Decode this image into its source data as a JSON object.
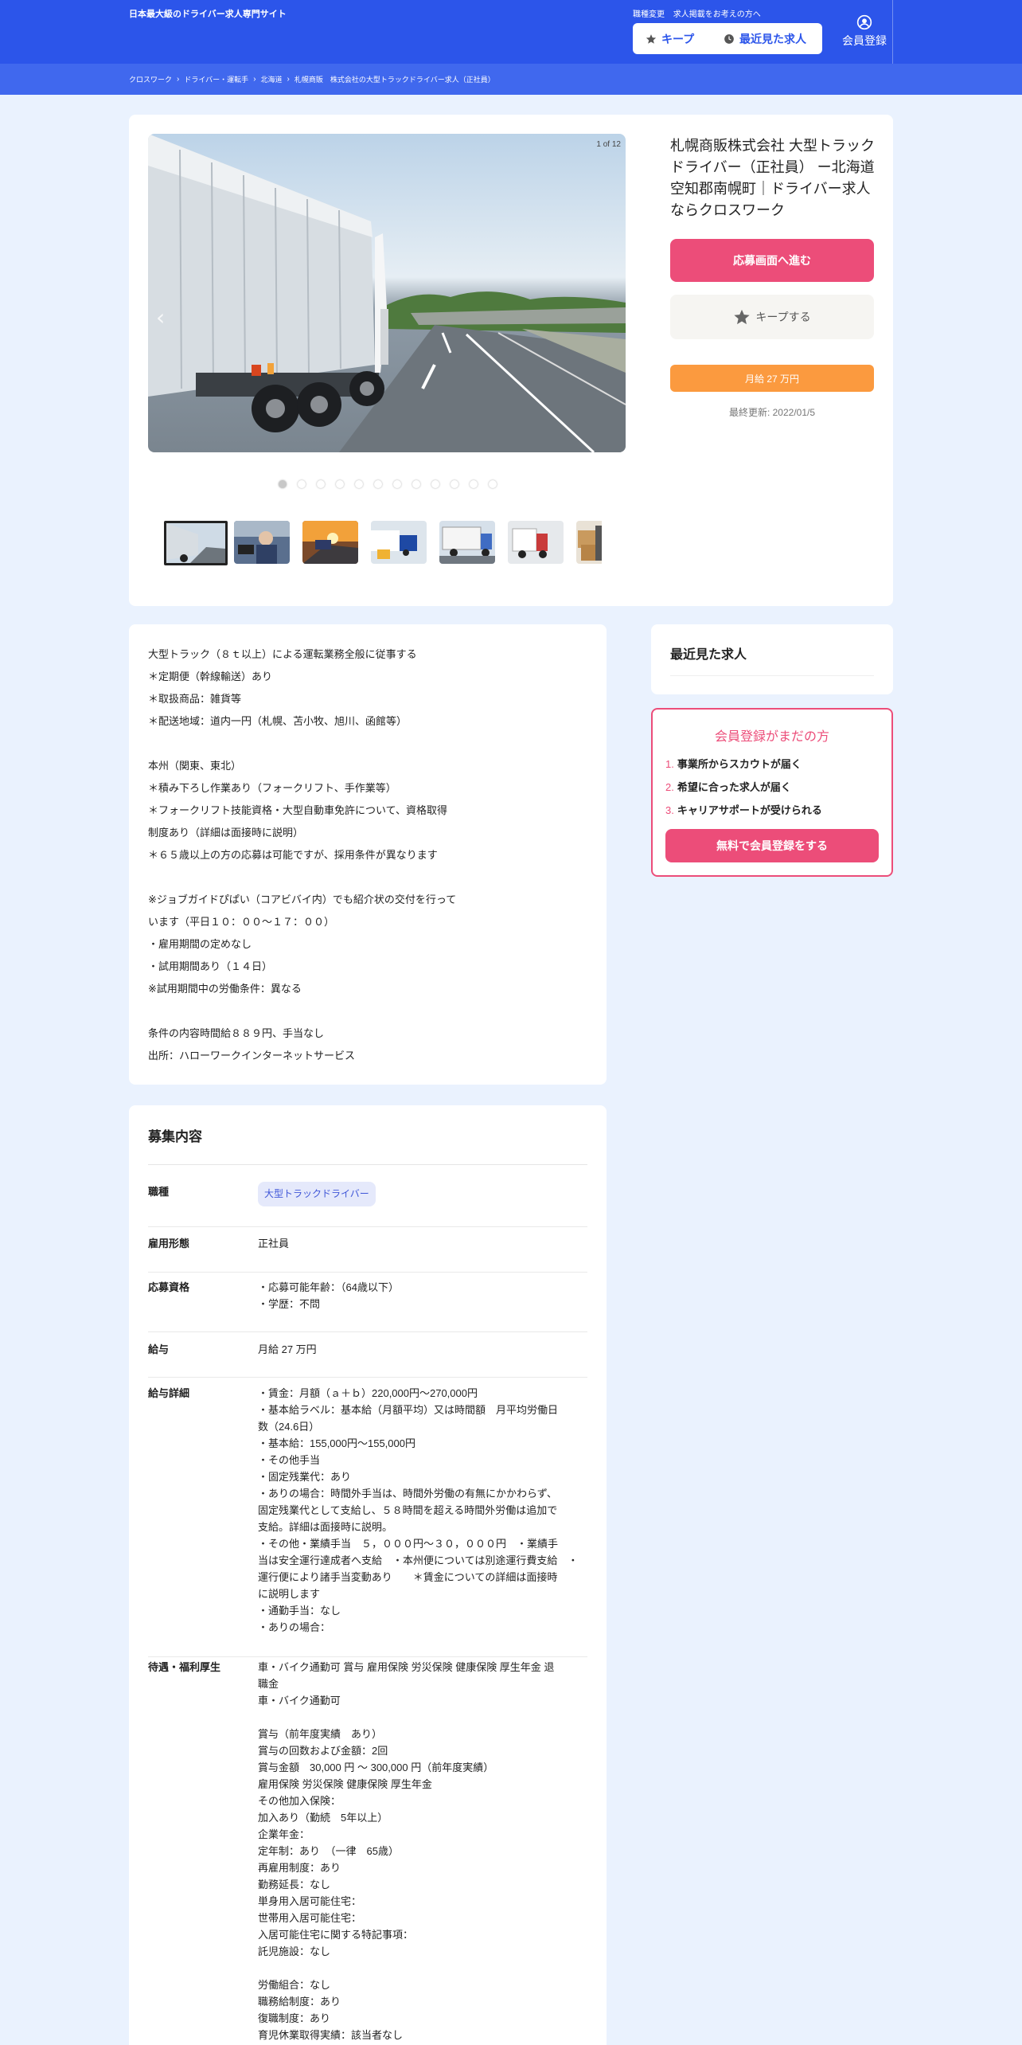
{
  "header": {
    "tagline": "日本最大級のドライバー求人専門サイト",
    "top_links": [
      "職種変更",
      "求人掲載をお考えの方へ"
    ],
    "keep_label": "キープ",
    "recent_label": "最近見た求人",
    "member_label": "会員登録",
    "accent": "#2c55ea"
  },
  "breadcrumb": [
    "クロスワーク",
    "ドライバー・運転手",
    "北海道",
    "札幌商販　株式会社の大型トラックドライバー求人（正社員）"
  ],
  "job": {
    "photo_counter": "1 of 12",
    "title": "札幌商販株式会社 大型トラックドライバー（正社員） ー北海道空知郡南幌町｜ドライバー求人ならクロスワーク",
    "apply_label": "応募画面へ進む",
    "keep_label": "キープする",
    "salary": "月給 27 万円",
    "updated": "最終更新: 2022/01/5",
    "slide_count": 12,
    "active_slide": 1
  },
  "description": [
    "大型トラック（８ｔ以上）による運転業務全般に従事する",
    "＊定期便（幹線輸送）あり",
    "＊取扱商品：雑貨等",
    "＊配送地域：道内一円（札幌、苫小牧、旭川、函館等）",
    "",
    "本州（関東、東北）",
    "＊積み下ろし作業あり（フォークリフト、手作業等）",
    "＊フォークリフト技能資格・大型自動車免許について、資格取得",
    "制度あり（詳細は面接時に説明）",
    "＊６５歳以上の方の応募は可能ですが、採用条件が異なります",
    "",
    "※ジョブガイドぴぱい（コアビバイ内）でも紹介状の交付を行って",
    "います（平日１０：００〜１７：００）",
    "・雇用期間の定めなし",
    "・試用期間あり（１４日）",
    "※試用期間中の労働条件：異なる",
    "",
    "条件の内容時間給８８９円、手当なし",
    "出所：ハローワークインターネットサービス"
  ],
  "recent": {
    "title": "最近見た求人"
  },
  "register": {
    "title": "会員登録がまだの方",
    "items": [
      {
        "num": "1.",
        "text": "事業所からスカウトが届く"
      },
      {
        "num": "2.",
        "text": "希望に合った求人が届く"
      },
      {
        "num": "3.",
        "text": "キャリアサポートが受けられる"
      }
    ],
    "button": "無料で会員登録をする",
    "accent": "#ec4d79"
  },
  "requirements": {
    "title": "募集内容",
    "job_type_label": "職種",
    "job_type_chip": "大型トラックドライバー",
    "employment_label": "雇用形態",
    "employment": [
      "正社員"
    ],
    "qualification_label": "応募資格",
    "qualification": [
      "・応募可能年齢：（64歳以下）",
      "・学歴：不問"
    ],
    "salary_label": "給与",
    "salary": [
      "月給 27 万円"
    ],
    "salary_detail_label": "給与詳細",
    "salary_detail": [
      "・賃金：月額（ａ＋ｂ）220,000円〜270,000円",
      "・基本給ラベル：基本給（月額平均）又は時間額　月平均労働日",
      "数（24.6日）",
      "・基本給：155,000円〜155,000円",
      "・その他手当",
      "・固定残業代：あり",
      "・ありの場合：時間外手当は、時間外労働の有無にかかわらず、",
      "固定残業代として支給し、５８時間を超える時間外労働は追加で",
      "支給。詳細は面接時に説明。",
      "・その他・業績手当　５，０００円〜３０，０００円　・業績手",
      "当は安全運行達成者へ支給　・本州便については別途運行費支給　・",
      "運行便により諸手当変動あり　　＊賃金についての詳細は面接時",
      "に説明します",
      "・通勤手当：なし",
      "・ありの場合："
    ],
    "benefits_label": "待遇・福利厚生",
    "benefits": [
      "車・バイク通勤可 賞与 雇用保険 労災保険 健康保険 厚生年金 退",
      "職金",
      "車・バイク通勤可",
      "",
      "賞与（前年度実績　あり）",
      "賞与の回数および金額：2回",
      "賞与金額　30,000 円 〜 300,000 円（前年度実績）",
      "雇用保険 労災保険 健康保険 厚生年金",
      "その他加入保険：",
      "加入あり（勤続　5年以上）",
      "企業年金：",
      "定年制：あり　（一律　65歳）",
      "再雇用制度：あり",
      "勤務延長：なし",
      "単身用入居可能住宅：",
      "世帯用入居可能住宅：",
      "入居可能住宅に関する特記事項：",
      "託児施設：なし",
      "",
      "労働組合：なし",
      "職務給制度：あり",
      "復職制度：あり",
      "育児休業取得実績：該当者なし"
    ]
  }
}
